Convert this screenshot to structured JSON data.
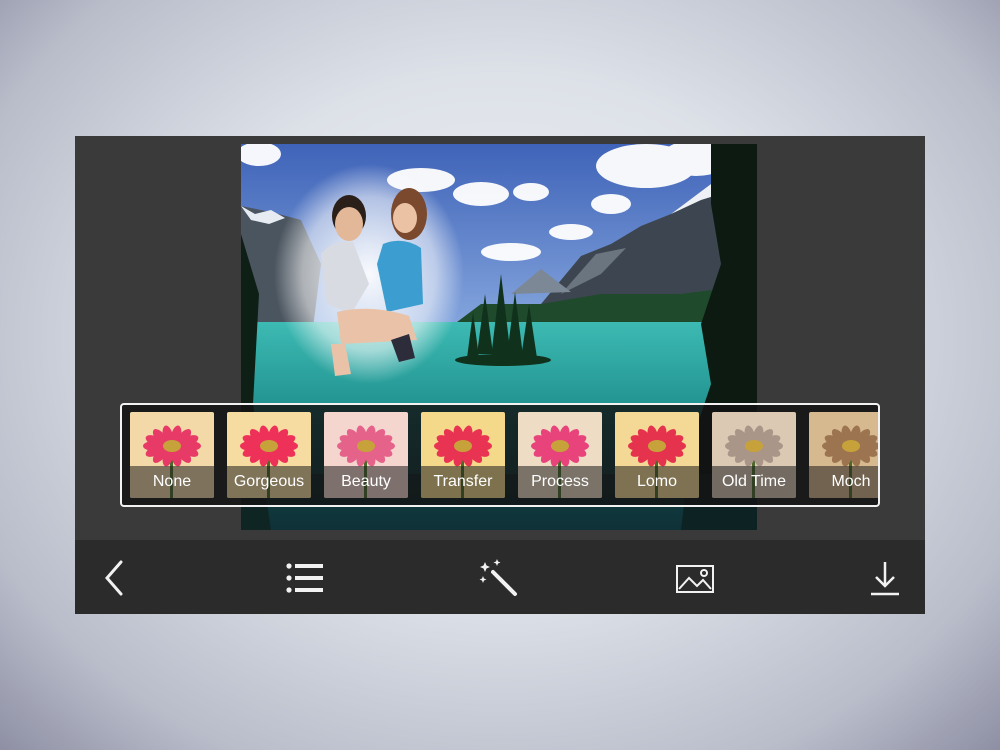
{
  "filters": [
    {
      "label": "None",
      "tint": "#f3d9a8",
      "petal": "#e83a67",
      "selected": true
    },
    {
      "label": "Gorgeous",
      "tint": "#f6dca0",
      "petal": "#ee3159",
      "selected": false
    },
    {
      "label": "Beauty",
      "tint": "#f4d6cf",
      "petal": "#e5628a",
      "selected": false
    },
    {
      "label": "Transfer",
      "tint": "#f4d98a",
      "petal": "#e93352",
      "selected": false
    },
    {
      "label": "Process",
      "tint": "#eedcc4",
      "petal": "#e8437a",
      "selected": false
    },
    {
      "label": "Lomo",
      "tint": "#f3d995",
      "petal": "#e5334e",
      "selected": false
    },
    {
      "label": "Old Time",
      "tint": "#dcc9b4",
      "petal": "#aa9689",
      "selected": false
    },
    {
      "label": "Moch",
      "tint": "#d7b98f",
      "petal": "#9c7550",
      "selected": false
    }
  ],
  "toolbar": {
    "back": "chevron-left-icon",
    "list": "list-icon",
    "effects": "magic-wand-icon",
    "gallery": "image-icon",
    "download": "download-icon"
  },
  "colors": {
    "selection": "#1f56d8",
    "toolbar_bg": "#2b2b2b",
    "panel_bg": "#3a3a3a"
  }
}
